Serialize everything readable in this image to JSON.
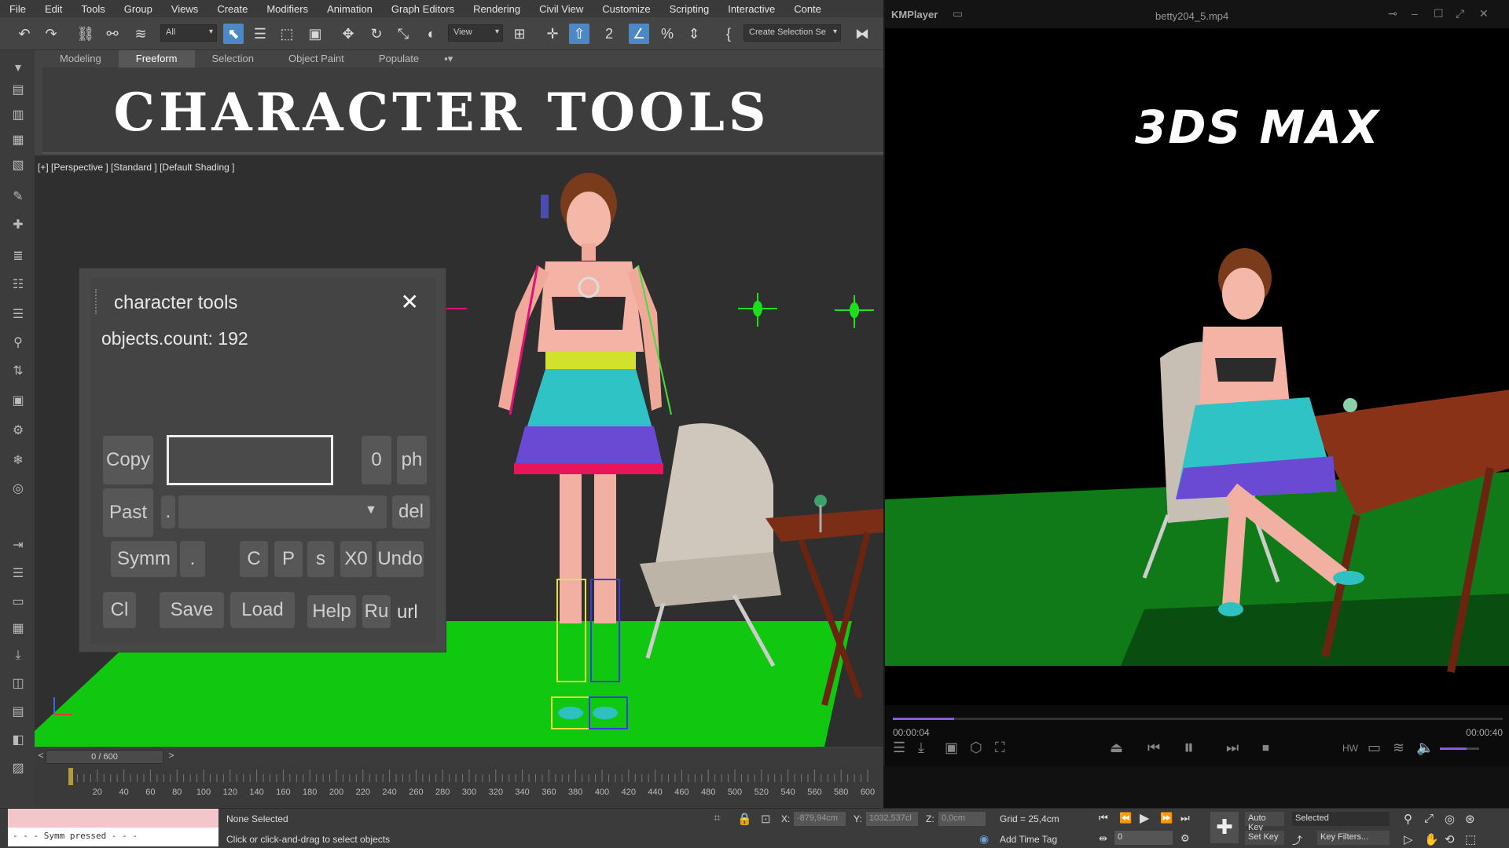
{
  "max": {
    "menu": [
      "File",
      "Edit",
      "Tools",
      "Group",
      "Views",
      "Create",
      "Modifiers",
      "Animation",
      "Graph Editors",
      "Rendering",
      "Civil View",
      "Customize",
      "Scripting",
      "Interactive",
      "Conte"
    ],
    "toolbar": {
      "filter_value": "All",
      "refcoord_value": "View",
      "selection_set_placeholder": "Create Selection Se"
    },
    "ribbon_tabs": [
      "Modeling",
      "Freeform",
      "Selection",
      "Object Paint",
      "Populate"
    ],
    "ribbon_active": "Freeform",
    "overlay_title": "CHARACTER TOOLS",
    "viewport_label": "[+] [Perspective ] [Standard ] [Default Shading ]",
    "char_tools": {
      "title": "character tools",
      "close": "✕",
      "count_label": "objects.count: 192",
      "copy": "Copy",
      "num_value": "0",
      "ph": "ph",
      "past": "Past",
      "dot": ".",
      "del": "del",
      "symm": "Symm",
      "c": "C",
      "p": "P",
      "s": "s",
      "x0": "X0",
      "undo": "Undo",
      "cl": "Cl",
      "save": "Save",
      "load": "Load",
      "help": "Help",
      "ru": "Ru",
      "url": "url"
    },
    "time_slider": "0 / 600",
    "timeline_ticks": [
      "20",
      "40",
      "60",
      "80",
      "100",
      "120",
      "140",
      "160",
      "180",
      "200",
      "220",
      "240",
      "260",
      "280",
      "300",
      "320",
      "340",
      "360",
      "380",
      "400",
      "420",
      "440",
      "460",
      "480",
      "500",
      "520",
      "540",
      "560",
      "580",
      "600"
    ],
    "status": {
      "script_line": "- - - Symm pressed - - -",
      "selection": "None Selected",
      "prompt": "Click or click-and-drag to select objects",
      "x_label": "X:",
      "x_value": "-879,94cm",
      "y_label": "Y:",
      "y_value": "1032,537cl",
      "z_label": "Z:",
      "z_value": "0,0cm",
      "grid": "Grid = 25,4cm",
      "add_time_tag": "Add Time Tag",
      "auto_key": "Auto Key",
      "set_key": "Set Key",
      "selected_value": "Selected",
      "frame_value": "0",
      "key_filters": "Key Filters..."
    }
  },
  "km": {
    "app": "KMPlayer",
    "file": "betty204_5.mp4",
    "overlay": "3DS MAX",
    "time_current": "00:00:04",
    "time_total": "00:00:40",
    "progress": 0.1
  }
}
